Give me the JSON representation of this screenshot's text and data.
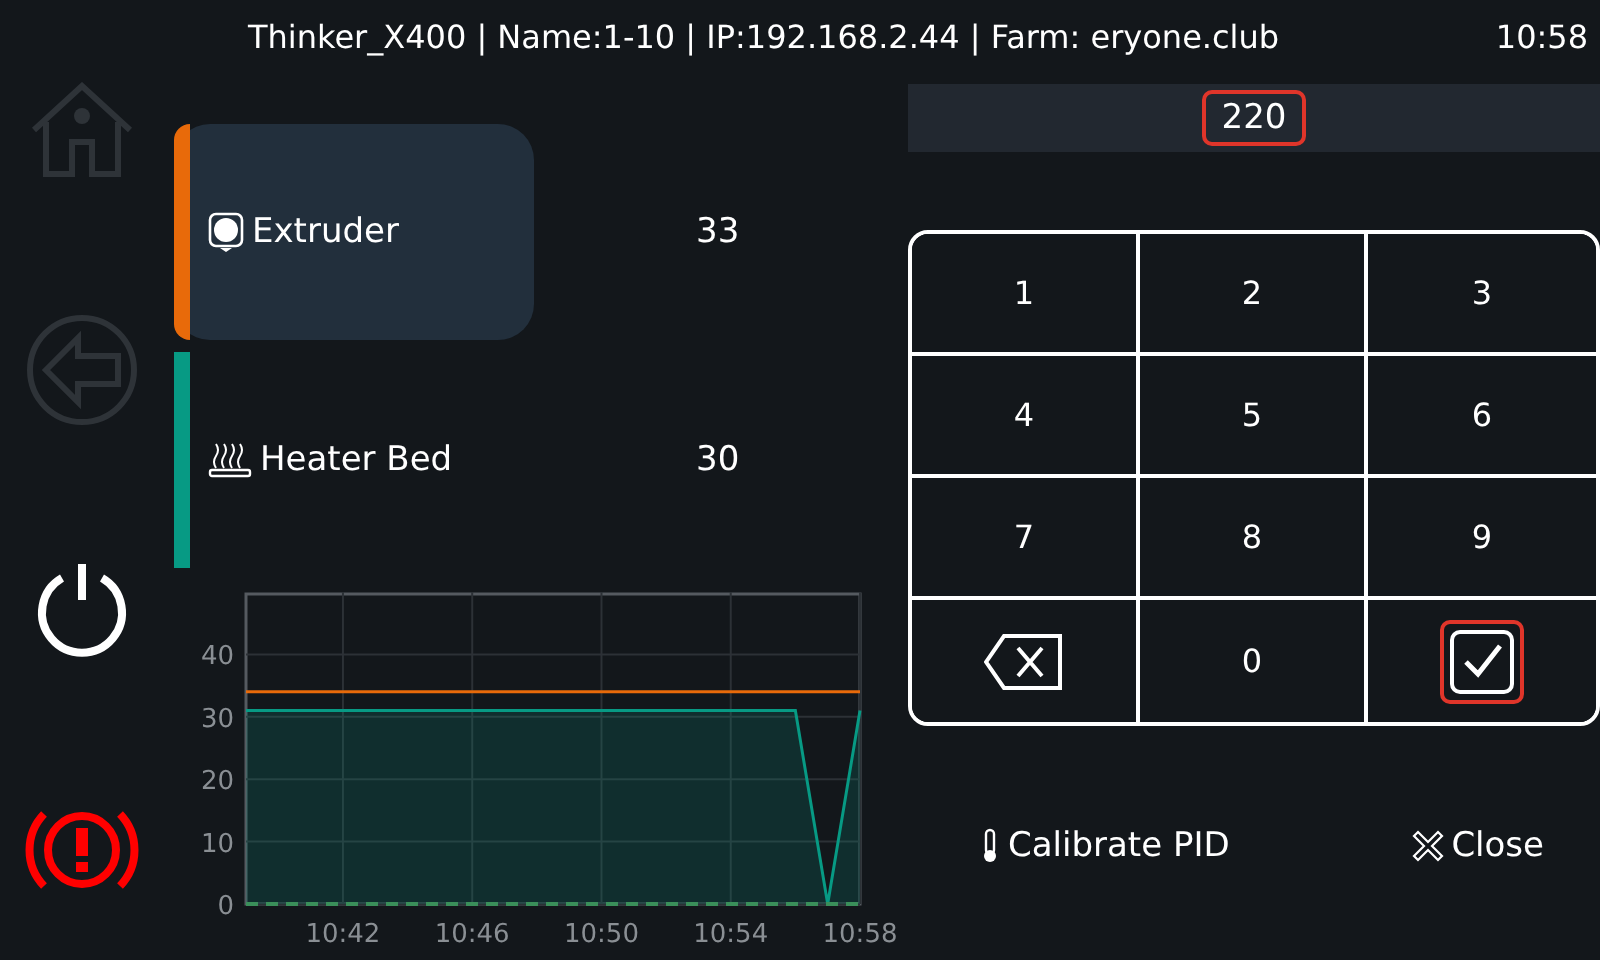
{
  "header": {
    "title": "Thinker_X400 | Name:1-10 | IP:192.168.2.44 | Farm: eryone.club",
    "time": "10:58"
  },
  "nav": [
    {
      "kind": "home",
      "disabled": true
    },
    {
      "kind": "back",
      "disabled": true
    },
    {
      "kind": "power",
      "disabled": false
    },
    {
      "kind": "emergency",
      "disabled": false
    }
  ],
  "sensors": [
    {
      "kind": "extruder",
      "name": "Extruder",
      "value": "33",
      "selected": true,
      "color": "#e86a0a"
    },
    {
      "kind": "bed",
      "name": "Heater Bed",
      "value": "30",
      "selected": false,
      "color": "#079a84"
    }
  ],
  "chart": {
    "chart_data": {
      "type": "line",
      "categories": [
        null,
        null,
        null,
        "10:42",
        null,
        null,
        null,
        "10:46",
        null,
        null,
        null,
        "10:50",
        null,
        null,
        null,
        "10:54",
        null,
        null,
        null,
        "10:58"
      ],
      "ylim": [
        0,
        50
      ],
      "yticks": [
        0,
        10,
        20,
        30,
        40
      ],
      "grid": true,
      "series": [
        {
          "color": "#e86a0a",
          "values": [
            34,
            34,
            34,
            34,
            34,
            34,
            34,
            34,
            34,
            34,
            34,
            34,
            34,
            34,
            34,
            34,
            34,
            34,
            34,
            34
          ]
        },
        {
          "color": "#079a84",
          "values": [
            31,
            31,
            31,
            31,
            31,
            31,
            31,
            31,
            31,
            31,
            31,
            31,
            31,
            31,
            31,
            31,
            31,
            31,
            0,
            31
          ]
        },
        {
          "color": "#3a8f5a",
          "line_style": "dashed",
          "values": [
            0,
            0,
            0,
            0,
            0,
            0,
            0,
            0,
            0,
            0,
            0,
            0,
            0,
            0,
            0,
            0,
            0,
            0,
            0,
            0
          ]
        }
      ]
    }
  },
  "display": {
    "value": "220",
    "highlighted": true
  },
  "keypad": [
    {
      "kind": "digit",
      "label": "1",
      "highlighted": false
    },
    {
      "kind": "digit",
      "label": "2",
      "highlighted": false
    },
    {
      "kind": "digit",
      "label": "3",
      "highlighted": false
    },
    {
      "kind": "digit",
      "label": "4",
      "highlighted": false
    },
    {
      "kind": "digit",
      "label": "5",
      "highlighted": false
    },
    {
      "kind": "digit",
      "label": "6",
      "highlighted": false
    },
    {
      "kind": "digit",
      "label": "7",
      "highlighted": false
    },
    {
      "kind": "digit",
      "label": "8",
      "highlighted": false
    },
    {
      "kind": "digit",
      "label": "9",
      "highlighted": false
    },
    {
      "kind": "backspace",
      "highlighted": false
    },
    {
      "kind": "digit",
      "label": "0",
      "highlighted": false
    },
    {
      "kind": "confirm",
      "highlighted": true
    }
  ],
  "actions": [
    {
      "kind": "calibrate",
      "label": "Calibrate PID"
    },
    {
      "kind": "close",
      "label": "Close"
    }
  ]
}
